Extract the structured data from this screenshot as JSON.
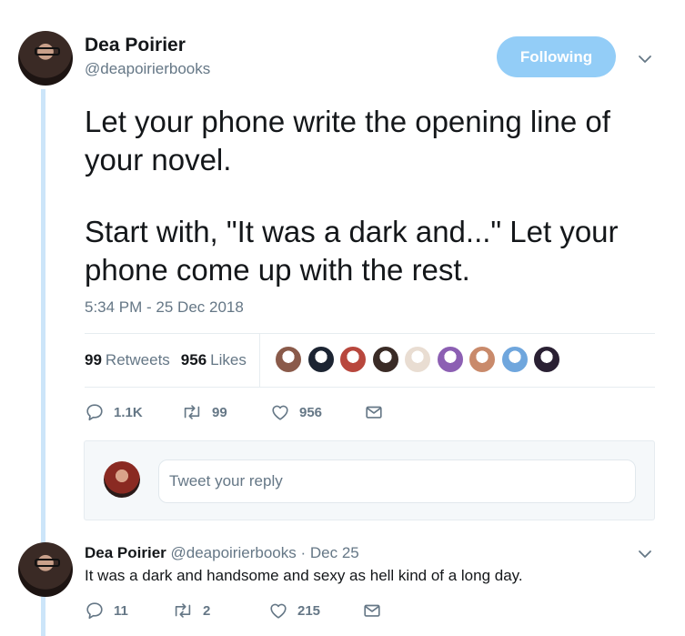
{
  "tweet": {
    "author_name": "Dea Poirier",
    "author_handle": "@deapoirierbooks",
    "follow_label": "Following",
    "text_paragraph_1": "Let your phone write the opening line of your novel.",
    "text_paragraph_2": "Start with, \"It was a dark and...\" Let your phone come up with the rest.",
    "timestamp": "5:34 PM - 25 Dec 2018",
    "retweets_count": "99",
    "retweets_label": "Retweets",
    "likes_count": "956",
    "likes_label": "Likes",
    "actions": {
      "replies": "1.1K",
      "retweets": "99",
      "likes": "956"
    }
  },
  "likers": [
    {
      "color": "#8a5a4a"
    },
    {
      "color": "#1c2432"
    },
    {
      "color": "#b8473d"
    },
    {
      "color": "#3a2b26"
    },
    {
      "color": "#e9ddd2"
    },
    {
      "color": "#8c5fb3"
    },
    {
      "color": "#c98a6b"
    },
    {
      "color": "#6fa6dd"
    },
    {
      "color": "#2a2033"
    }
  ],
  "reply_box": {
    "placeholder": "Tweet your reply"
  },
  "reply": {
    "author_name": "Dea Poirier",
    "author_handle": "@deapoirierbooks",
    "separator": "·",
    "date": "Dec 25",
    "text": "It was a dark and handsome and sexy as hell kind of a long day.",
    "actions": {
      "replies": "11",
      "retweets": "2",
      "likes": "215"
    }
  },
  "colors": {
    "accent": "#1da1f2",
    "following_button": "#93cdf7",
    "secondary_text": "#657786",
    "thread_line": "#cce5f9"
  }
}
